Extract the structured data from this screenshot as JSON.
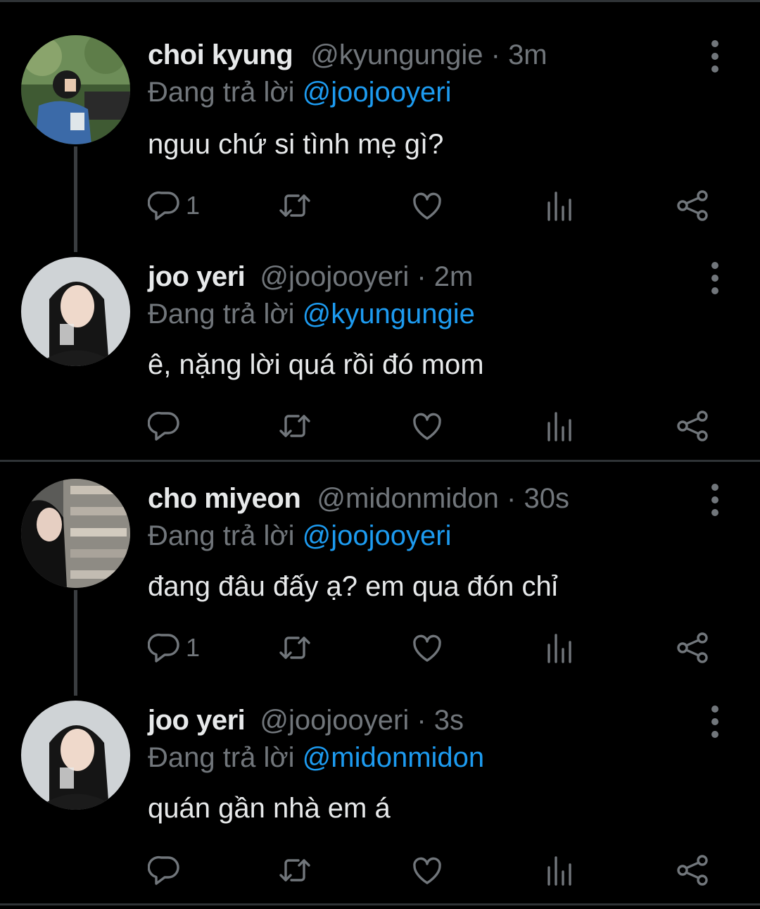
{
  "tweets": [
    {
      "name": "choi kyung",
      "handle": "@kyungungie",
      "sep": "·",
      "time": "3m",
      "reply_prefix": "Đang trả lời",
      "reply_to": "@joojooyeri",
      "text": "nguu chứ si tình mẹ gì?",
      "reply_count": "1"
    },
    {
      "name": "joo yeri",
      "handle": "@joojooyeri",
      "sep": "·",
      "time": "2m",
      "reply_prefix": "Đang trả lời",
      "reply_to": "@kyungungie",
      "text": "ê, nặng lời quá rồi đó mom",
      "reply_count": ""
    },
    {
      "name": "cho miyeon",
      "handle": "@midonmidon",
      "sep": "·",
      "time": "30s",
      "reply_prefix": "Đang trả lời",
      "reply_to": "@joojooyeri",
      "text": "đang đâu đấy ạ? em qua đón chỉ",
      "reply_count": "1"
    },
    {
      "name": "joo yeri",
      "handle": "@joojooyeri",
      "sep": "·",
      "time": "3s",
      "reply_prefix": "Đang trả lời",
      "reply_to": "@midonmidon",
      "text": "quán gần nhà em á",
      "reply_count": ""
    }
  ],
  "icons": {
    "reply": "reply-icon",
    "retweet": "retweet-icon",
    "like": "heart-icon",
    "views": "analytics-icon",
    "share": "share-icon",
    "more": "more-vertical-icon"
  },
  "colors": {
    "background": "#000000",
    "text": "#e7e9ea",
    "muted": "#71767b",
    "mention": "#1d9bf0",
    "divider": "#2f3336"
  }
}
